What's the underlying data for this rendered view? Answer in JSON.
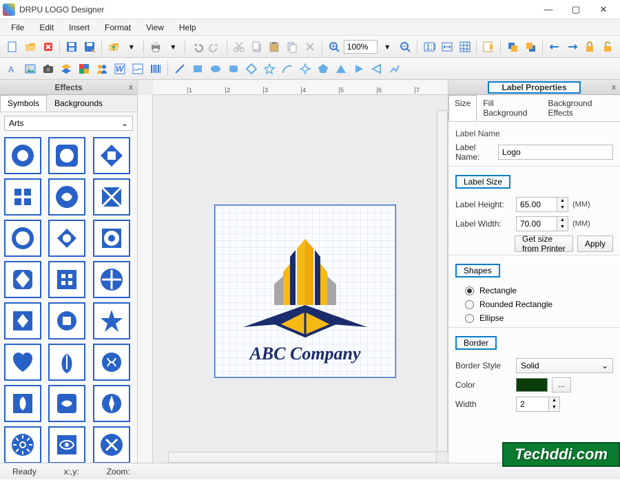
{
  "window": {
    "title": "DRPU LOGO Designer"
  },
  "menu": {
    "items": [
      "File",
      "Edit",
      "Insert",
      "Format",
      "View",
      "Help"
    ]
  },
  "toolbar": {
    "zoom": "100%"
  },
  "effects": {
    "title": "Effects",
    "tabs": [
      "Symbols",
      "Backgrounds"
    ],
    "active_tab": 0,
    "category": "Arts"
  },
  "ruler": {
    "marks": [
      "1",
      "2",
      "3",
      "4",
      "5",
      "6",
      "7"
    ]
  },
  "canvas": {
    "company_text": "ABC Company"
  },
  "props": {
    "title": "Label Properties",
    "tabs": [
      "Size",
      "Fill Background",
      "Background Effects"
    ],
    "active_tab": 0,
    "group_label_name": "Label Name",
    "label_name_label": "Label Name:",
    "label_name_value": "Logo",
    "group_label_size": "Label Size",
    "height_label": "Label Height:",
    "height_value": "65.00",
    "width_label": "Label Width:",
    "width_value": "70.00",
    "unit": "(MM)",
    "btn_get_size": "Get size from Printer",
    "btn_apply": "Apply",
    "group_shapes": "Shapes",
    "shape_options": [
      "Rectangle",
      "Rounded Rectangle",
      "Ellipse"
    ],
    "shape_selected": 0,
    "group_border": "Border",
    "border_style_label": "Border Style",
    "border_style_value": "Solid",
    "border_color_label": "Color",
    "border_color_value": "#0b3d0b",
    "color_btn": "...",
    "border_width_label": "Width",
    "border_width_value": "2"
  },
  "status": {
    "ready": "Ready",
    "xy": "x:,y:",
    "zoom": "Zoom:"
  },
  "watermark": "Techddi.com"
}
